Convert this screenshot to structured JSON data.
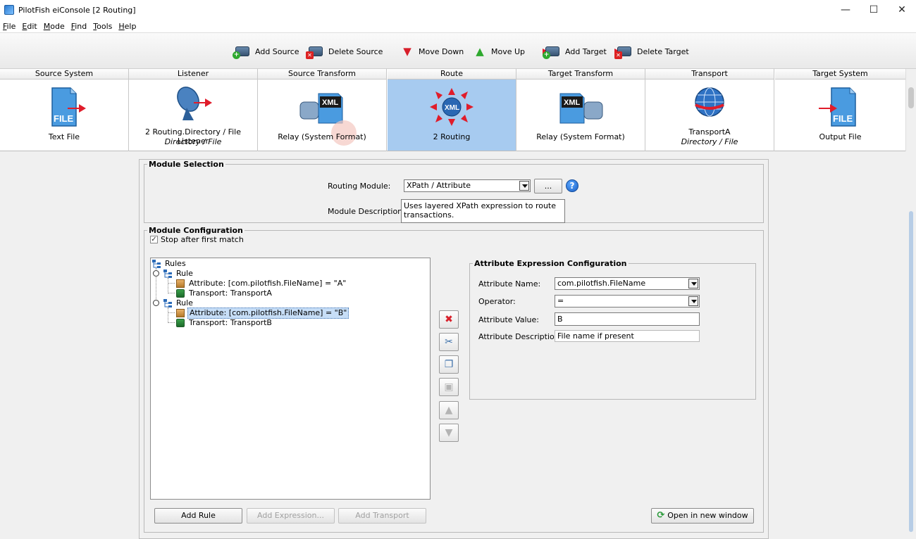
{
  "window": {
    "title": "PilotFish eiConsole [2 Routing]",
    "minimize": "—",
    "maximize": "☐",
    "close": "✕"
  },
  "menu": [
    {
      "label_u": "F",
      "label_rest": "ile"
    },
    {
      "label_u": "E",
      "label_rest": "dit"
    },
    {
      "label_u": "M",
      "label_rest": "ode"
    },
    {
      "label_u": "F",
      "label_rest": "ind"
    },
    {
      "label_u": "T",
      "label_rest": "ools"
    },
    {
      "label_u": "H",
      "label_rest": "elp"
    }
  ],
  "toolbar": {
    "add_source": "Add Source",
    "delete_source": "Delete Source",
    "move_down": "Move Down",
    "move_up": "Move Up",
    "add_target": "Add Target",
    "delete_target": "Delete Target"
  },
  "pipeline": {
    "stages": [
      {
        "header": "Source System",
        "label": "Text File",
        "sub": ""
      },
      {
        "header": "Listener",
        "label": "2 Routing.Directory / File Listener",
        "sub": "Directory / File"
      },
      {
        "header": "Source Transform",
        "label": "Relay (System Format)",
        "sub": ""
      },
      {
        "header": "Route",
        "label": "2 Routing",
        "sub": ""
      },
      {
        "header": "Target Transform",
        "label": "Relay (System Format)",
        "sub": ""
      },
      {
        "header": "Transport",
        "label": "TransportA",
        "sub": "Directory / File"
      },
      {
        "header": "Target System",
        "label": "Output File",
        "sub": ""
      }
    ],
    "icon_text": {
      "file": "FILE",
      "xml": "XML"
    }
  },
  "module_selection": {
    "legend": "Module Selection",
    "routing_module_label": "Routing Module:",
    "routing_module_value": "XPath / Attribute",
    "browse_button": "...",
    "help": "?",
    "description_label": "Module Description:",
    "description_value": "Uses layered XPath expression to route transactions."
  },
  "module_configuration": {
    "legend": "Module Configuration",
    "stop_after_first_match": "Stop after first match",
    "stop_after_first_match_checked": true,
    "tree": {
      "root": "Rules",
      "rules": [
        {
          "label": "Rule",
          "attribute": "Attribute: [com.pilotfish.FileName] = \"A\"",
          "transport": "Transport: TransportA"
        },
        {
          "label": "Rule",
          "attribute": "Attribute: [com.pilotfish.FileName] = \"B\"",
          "transport": "Transport: TransportB"
        }
      ]
    },
    "buttons": {
      "add_rule": "Add Rule",
      "add_expression": "Add Expression...",
      "add_transport": "Add Transport",
      "open_new_window": "Open in new window"
    }
  },
  "attribute_config": {
    "legend": "Attribute Expression Configuration",
    "name_label": "Attribute Name:",
    "name_value": "com.pilotfish.FileName",
    "operator_label": "Operator:",
    "operator_value": "=",
    "value_label": "Attribute Value:",
    "value_value": "B",
    "description_label": "Attribute Description:",
    "description_value": "File name if present"
  }
}
